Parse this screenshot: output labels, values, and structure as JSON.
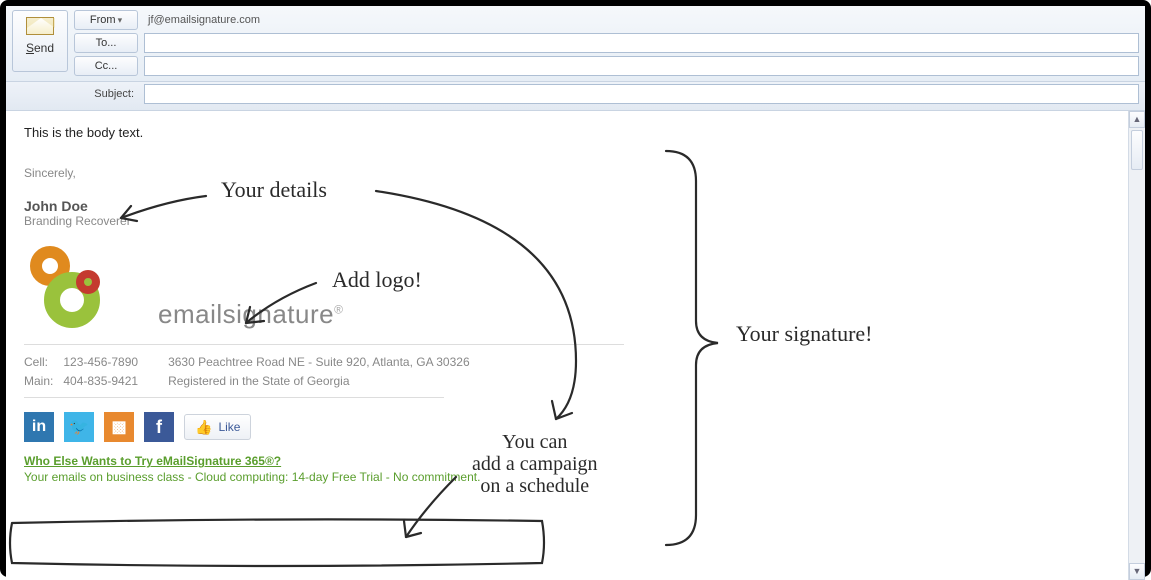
{
  "header": {
    "send_label": "Send",
    "from_label": "From",
    "from_value": "jf@emailsignature.com",
    "to_label": "To...",
    "cc_label": "Cc...",
    "subject_label": "Subject:",
    "to_value": "",
    "cc_value": "",
    "subject_value": ""
  },
  "body": {
    "text": "This is the body text.",
    "closing": "Sincerely,",
    "name": "John Doe",
    "title": "Branding Recoverer",
    "brand": "emailsignature",
    "brand_reg": "®",
    "contact": {
      "cell_label": "Cell:",
      "cell": "123-456-7890",
      "main_label": "Main:",
      "main": "404-835-9421",
      "address": "3630 Peachtree Road NE - Suite 920, Atlanta, GA 30326",
      "registered": "Registered in the State of Georgia"
    },
    "like_label": "Like",
    "promo_link": "Who Else Wants to Try eMailSignature 365®?",
    "promo_sub": "Your emails on business class - Cloud computing: 14-day Free Trial - No commitment."
  },
  "annotations": {
    "details": "Your details",
    "addlogo": "Add logo!",
    "signature": "Your signature!",
    "campaign_l1": "You can",
    "campaign_l2": "add a campaign",
    "campaign_l3": "on a schedule"
  },
  "icons": {
    "in": "in",
    "tw": "🐦",
    "rss": "▩",
    "fb": "f",
    "thumb": "👍"
  }
}
